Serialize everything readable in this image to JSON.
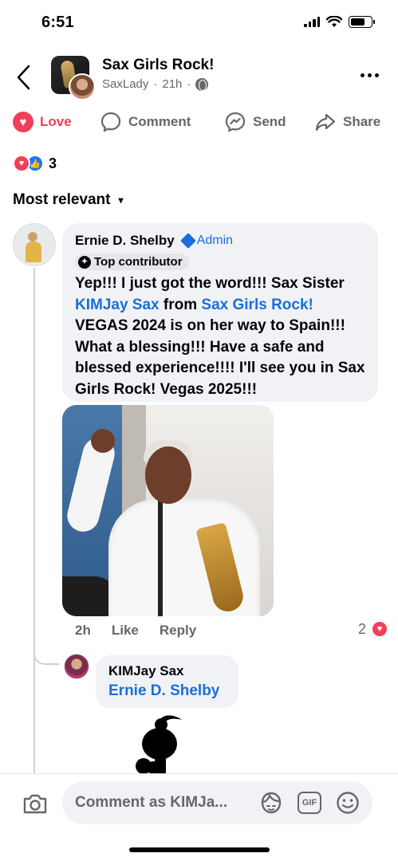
{
  "status_bar": {
    "time": "6:51"
  },
  "header": {
    "group_name": "Sax Girls Rock!",
    "author": "SaxLady",
    "separator": "·",
    "time": "21h",
    "separator2": "·"
  },
  "actions": {
    "love": "Love",
    "comment": "Comment",
    "send": "Send",
    "share": "Share"
  },
  "reactions": {
    "count": "3"
  },
  "sort": {
    "label": "Most relevant"
  },
  "comment": {
    "author": "Ernie D. Shelby",
    "role": "Admin",
    "badge": "Top contributor",
    "text_1": "Yep!!! I just  got the word!!! Sax Sister",
    "mention_1": "KIMJay Sax",
    "text_2": " from ",
    "mention_2": "Sax Girls Rock!",
    "text_3": " VEGAS 2024 is on her way to Spain!!! What a blessing!!! Have a safe and blessed experience!!!! I'll see you in Sax Girls Rock! Vegas 2025!!!",
    "time": "2h",
    "like": "Like",
    "reply": "Reply",
    "reaction_count": "2"
  },
  "reply": {
    "author": "KIMJay Sax",
    "mention": "Ernie D. Shelby"
  },
  "composer": {
    "placeholder": "Comment as KIMJa...",
    "gif_label": "GIF"
  },
  "colors": {
    "love": "#f33e58",
    "like": "#1877f2",
    "link": "#1a6fd8",
    "secondary": "#65676b",
    "bubble": "#f0f2f5"
  }
}
